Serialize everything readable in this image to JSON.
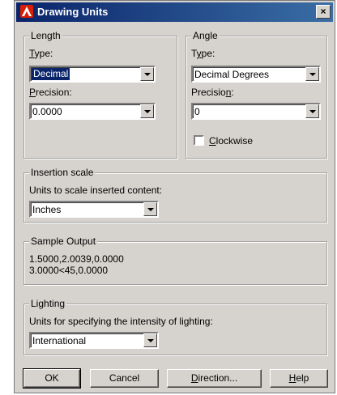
{
  "window": {
    "title": "Drawing Units",
    "close_glyph": "×"
  },
  "length": {
    "legend": "Length",
    "type_label_first": "T",
    "type_label_rest": "ype:",
    "type_value": "Decimal",
    "precision_label_first": "P",
    "precision_label_rest": "recision:",
    "precision_value": "0.0000"
  },
  "angle": {
    "legend": "Angle",
    "type_label_first": "T",
    "type_label_u": "y",
    "type_label_rest": "pe:",
    "type_value": "Decimal Degrees",
    "precision_label_first": "Precisio",
    "precision_label_u": "n",
    "precision_label_rest": ":",
    "precision_value": "0",
    "clockwise_u": "C",
    "clockwise_rest": "lockwise",
    "clockwise_checked": false
  },
  "insertion": {
    "legend": "Insertion scale",
    "label": "Units to scale inserted content:",
    "value": "Inches"
  },
  "sample": {
    "legend": "Sample Output",
    "line1": "1.5000,2.0039,0.0000",
    "line2": "3.0000<45,0.0000"
  },
  "lighting": {
    "legend": "Lighting",
    "label": "Units for specifying the intensity of lighting:",
    "value": "International"
  },
  "buttons": {
    "ok": "OK",
    "cancel": "Cancel",
    "direction_u": "D",
    "direction_rest": "irection...",
    "help_u": "H",
    "help_rest": "elp"
  },
  "colors": {
    "title_bar": "#0a246a",
    "dialog_bg": "#d6d3ce",
    "selection": "#0a246a"
  },
  "icons": [
    "autocad-logo-icon",
    "close-icon",
    "dropdown-arrow-icon"
  ]
}
